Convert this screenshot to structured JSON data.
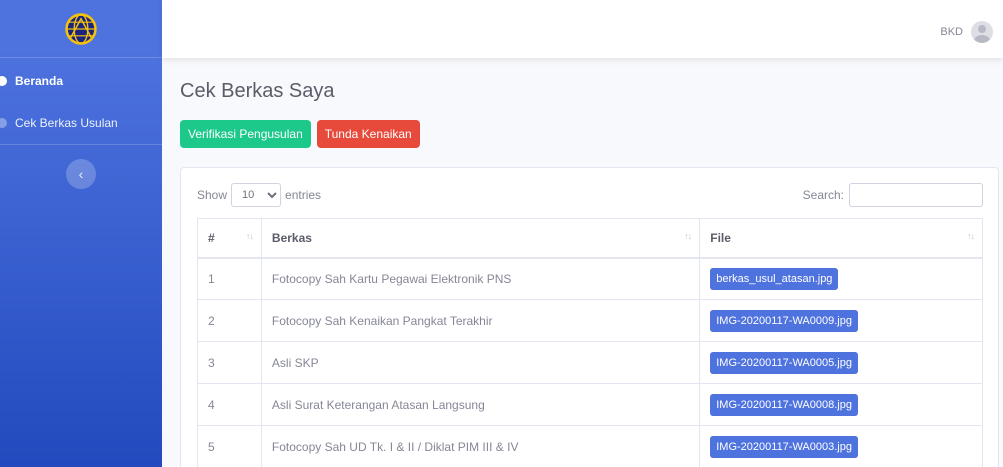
{
  "sidebar": {
    "items": [
      {
        "label": "Beranda"
      },
      {
        "label": "Cek Berkas Usulan"
      }
    ]
  },
  "topbar": {
    "user_name": "BKD"
  },
  "main": {
    "title": "Cek Berkas Saya",
    "buttons": {
      "verify": "Verifikasi Pengusulan",
      "hold": "Tunda Kenaikan"
    }
  },
  "table_controls": {
    "show_label": "Show",
    "entries_value": "10",
    "entries_label": "entries",
    "search_label": "Search:"
  },
  "table": {
    "headers": [
      "#",
      "Berkas",
      "File"
    ],
    "rows": [
      {
        "num": "1",
        "berkas": "Fotocopy Sah Kartu Pegawai Elektronik PNS",
        "file": "berkas_usul_atasan.jpg"
      },
      {
        "num": "2",
        "berkas": "Fotocopy Sah Kenaikan Pangkat Terakhir",
        "file": "IMG-20200117-WA0009.jpg"
      },
      {
        "num": "3",
        "berkas": "Asli SKP",
        "file": "IMG-20200117-WA0005.jpg"
      },
      {
        "num": "4",
        "berkas": "Asli Surat Keterangan Atasan Langsung",
        "file": "IMG-20200117-WA0008.jpg"
      },
      {
        "num": "5",
        "berkas": "Fotocopy Sah UD Tk. I & II / Diklat PIM III & IV",
        "file": "IMG-20200117-WA0003.jpg"
      }
    ]
  },
  "colors": {
    "primary": "#4e73df",
    "success": "#1cc88a",
    "danger": "#e74a3b"
  }
}
